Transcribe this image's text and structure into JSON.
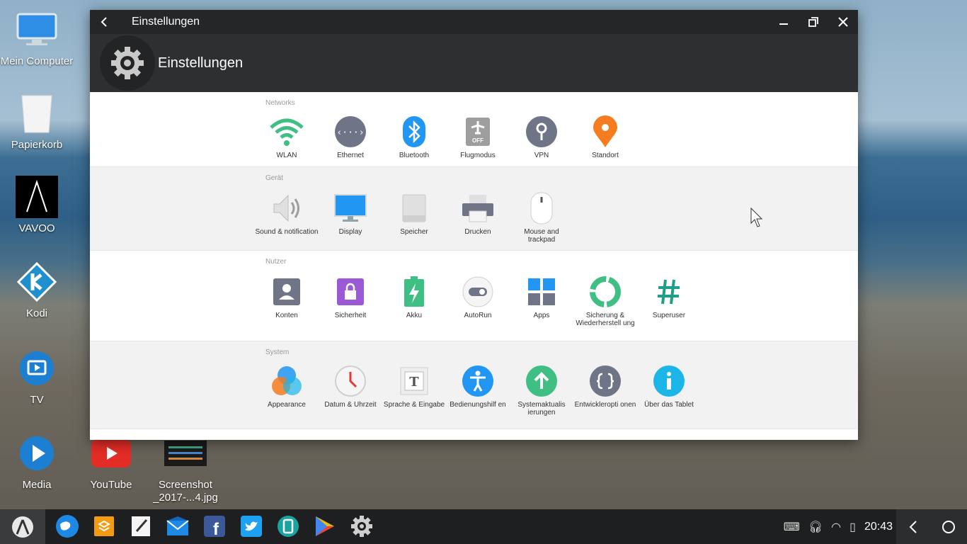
{
  "desktop": {
    "icons": [
      {
        "label": "Mein Computer",
        "icon": "computer-icon"
      },
      {
        "label": "Papierkorb",
        "icon": "trash-icon"
      },
      {
        "label": "VAVOO",
        "icon": "vavoo-icon"
      },
      {
        "label": "Kodi",
        "icon": "kodi-icon"
      },
      {
        "label": "TV",
        "icon": "tv-icon"
      },
      {
        "label": "Media",
        "icon": "media-icon"
      },
      {
        "label": "YouTube",
        "icon": "youtube-icon"
      },
      {
        "label": "Screenshot _2017-...4.jpg",
        "icon": "image-file-icon"
      }
    ]
  },
  "window": {
    "title": "Einstellungen",
    "header_title": "Einstellungen",
    "sections": [
      {
        "title": "Networks",
        "items": [
          {
            "label": "WLAN",
            "icon": "wifi-icon",
            "color": "#3fbf83"
          },
          {
            "label": "Ethernet",
            "icon": "ethernet-icon",
            "color": "#6f7486"
          },
          {
            "label": "Bluetooth",
            "icon": "bluetooth-icon",
            "color": "#2196f3"
          },
          {
            "label": "Flugmodus",
            "icon": "airplane-icon",
            "color": "#9e9e9e"
          },
          {
            "label": "VPN",
            "icon": "vpn-icon",
            "color": "#6f7486"
          },
          {
            "label": "Standort",
            "icon": "location-icon",
            "color": "#f57c1f"
          }
        ]
      },
      {
        "title": "Gerät",
        "items": [
          {
            "label": "Sound & notification",
            "icon": "speaker-icon",
            "color": "#9e9e9e"
          },
          {
            "label": "Display",
            "icon": "monitor-icon",
            "color": "#2196f3"
          },
          {
            "label": "Speicher",
            "icon": "storage-icon",
            "color": "#c8c8c8"
          },
          {
            "label": "Drucken",
            "icon": "printer-icon",
            "color": "#6f7486"
          },
          {
            "label": "Mouse and trackpad",
            "icon": "mouse-icon",
            "color": "#ffffff"
          }
        ]
      },
      {
        "title": "Nutzer",
        "items": [
          {
            "label": "Konten",
            "icon": "account-icon",
            "color": "#6f7486"
          },
          {
            "label": "Sicherheit",
            "icon": "lock-icon",
            "color": "#9b59d6"
          },
          {
            "label": "Akku",
            "icon": "battery-icon",
            "color": "#3fbf83"
          },
          {
            "label": "AutoRun",
            "icon": "toggle-icon",
            "color": "#6f7486"
          },
          {
            "label": "Apps",
            "icon": "apps-icon",
            "color": "#2196f3"
          },
          {
            "label": "Sicherung & Wiederherstell ung",
            "icon": "backup-icon",
            "color": "#3fbf83"
          },
          {
            "label": "Superuser",
            "icon": "hash-icon",
            "color": "#1f9e88"
          }
        ]
      },
      {
        "title": "System",
        "items": [
          {
            "label": "Appearance",
            "icon": "appearance-icon",
            "color": "#f57c1f"
          },
          {
            "label": "Datum & Uhrzeit",
            "icon": "clock-icon",
            "color": "#e53935"
          },
          {
            "label": "Sprache & Eingabe",
            "icon": "language-icon",
            "color": "#555555"
          },
          {
            "label": "Bedienungshilf en",
            "icon": "accessibility-icon",
            "color": "#2196f3"
          },
          {
            "label": "Systemaktualis ierungen",
            "icon": "update-icon",
            "color": "#3fbf83"
          },
          {
            "label": "Entwickleropti onen",
            "icon": "developer-icon",
            "color": "#6f7486"
          },
          {
            "label": "Über das Tablet",
            "icon": "info-icon",
            "color": "#1bb5e8"
          }
        ]
      }
    ]
  },
  "taskbar": {
    "apps": [
      "browser-icon",
      "files-icon",
      "notes-icon",
      "mail-icon",
      "facebook-icon",
      "twitter-icon",
      "tablet-icon",
      "play-store-icon",
      "settings-icon"
    ],
    "time": "20:43"
  }
}
